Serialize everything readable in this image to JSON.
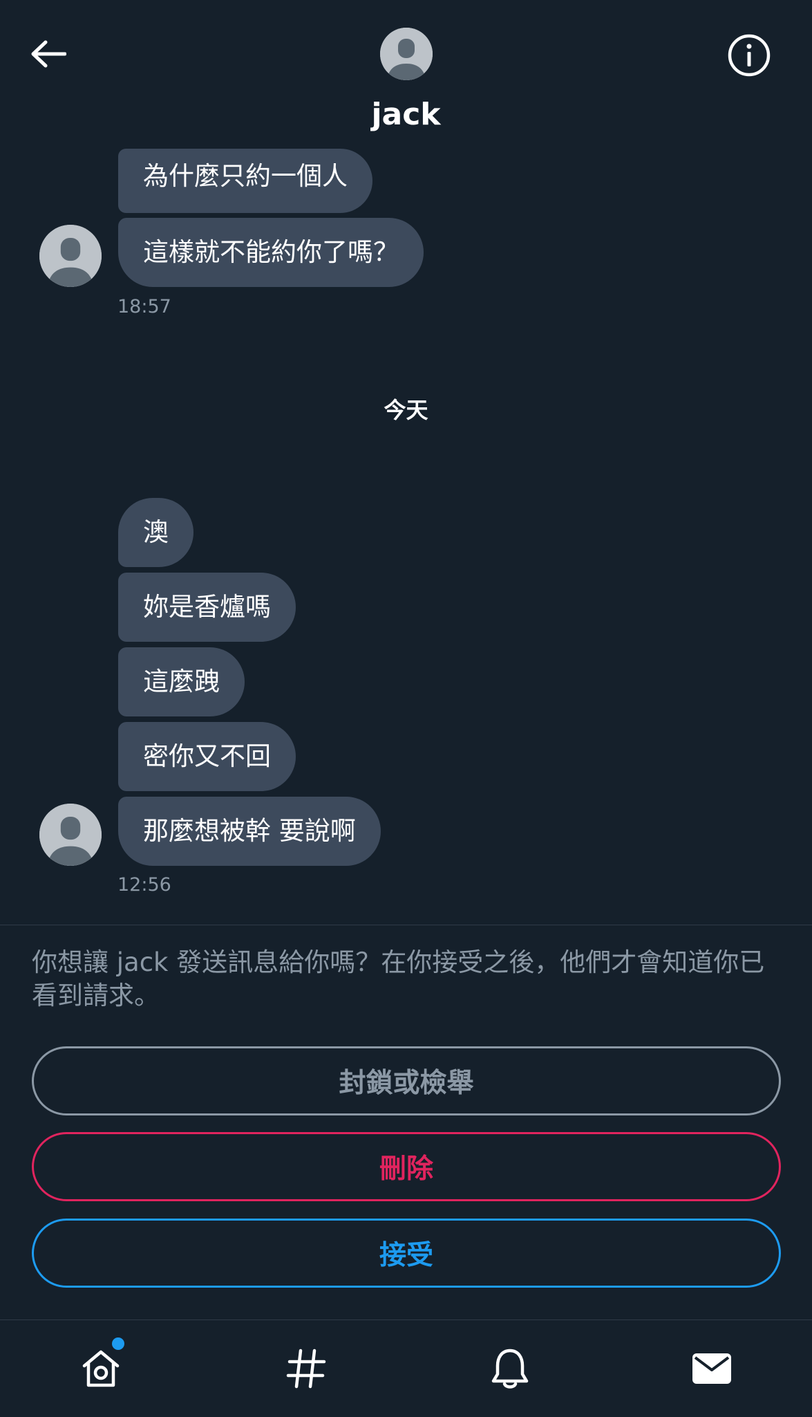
{
  "header": {
    "title": "jack",
    "back_icon": "arrow-left-icon",
    "info_icon": "info-circle-icon"
  },
  "conversation": {
    "group1": {
      "messages": [
        "為什麼只約一個人",
        "這樣就不能約你了嗎？"
      ],
      "time": "18:57"
    },
    "day_separator": "今天",
    "group2": {
      "messages": [
        "澳",
        "妳是香爐嗎",
        "這麼跩",
        "密你又不回",
        "那麼想被幹 要說啊"
      ],
      "time": "12:56"
    }
  },
  "request": {
    "text": "你想讓 jack 發送訊息給你嗎？在你接受之後，他們才會知道你已看到請求。",
    "block_label": "封鎖或檢舉",
    "delete_label": "刪除",
    "accept_label": "接受"
  },
  "nav": {
    "items": [
      "home-icon",
      "hashtag-icon",
      "bell-icon",
      "mail-icon"
    ]
  },
  "colors": {
    "background": "#15202b",
    "bubble": "#3d4a5c",
    "muted": "#8b98a5",
    "danger": "#e0245e",
    "accent": "#1d9bf0"
  }
}
